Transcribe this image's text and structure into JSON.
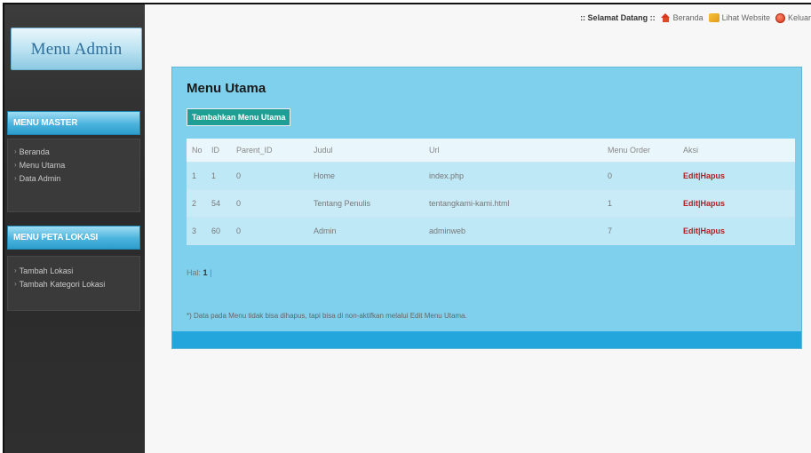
{
  "sidebar": {
    "logo_text": "Menu Admin",
    "sections": [
      {
        "title": "MENU MASTER",
        "items": [
          "Beranda",
          "Menu Utama",
          "Data Admin"
        ]
      },
      {
        "title": "MENU PETA LOKASI",
        "items": [
          "Tambah Lokasi",
          "Tambah Kategori Lokasi"
        ]
      }
    ]
  },
  "topbar": {
    "welcome": ":: Selamat Datang ::",
    "home": "Beranda",
    "website": "Lihat Website",
    "logout": "Keluar"
  },
  "main": {
    "title": "Menu Utama",
    "add_button": "Tambahkan Menu Utama",
    "columns": [
      "No",
      "ID",
      "Parent_ID",
      "Judul",
      "Url",
      "Menu Order",
      "Aksi"
    ],
    "rows": [
      {
        "no": "1",
        "id": "1",
        "parent_id": "0",
        "judul": "Home",
        "url": "index.php",
        "order": "0",
        "edit": "Edit",
        "sep": "|",
        "hapus": "Hapus"
      },
      {
        "no": "2",
        "id": "54",
        "parent_id": "0",
        "judul": "Tentang Penulis",
        "url": "tentangkami-kami.html",
        "order": "1",
        "edit": "Edit",
        "sep": "|",
        "hapus": "Hapus"
      },
      {
        "no": "3",
        "id": "60",
        "parent_id": "0",
        "judul": "Admin",
        "url": "adminweb",
        "order": "7",
        "edit": "Edit",
        "sep": "|",
        "hapus": "Hapus"
      }
    ],
    "pager_label": "Hal:",
    "pager_page": "1",
    "pager_sep": "|",
    "note": "*) Data pada Menu tidak bisa dihapus, tapi bisa di non-aktifkan melalui Edit Menu Utama."
  },
  "colors": {
    "panel_bg": "#7fd0ec",
    "accent_bar": "#23a6dc",
    "button_bg": "#1f9f93",
    "action_link": "#b01e22"
  }
}
